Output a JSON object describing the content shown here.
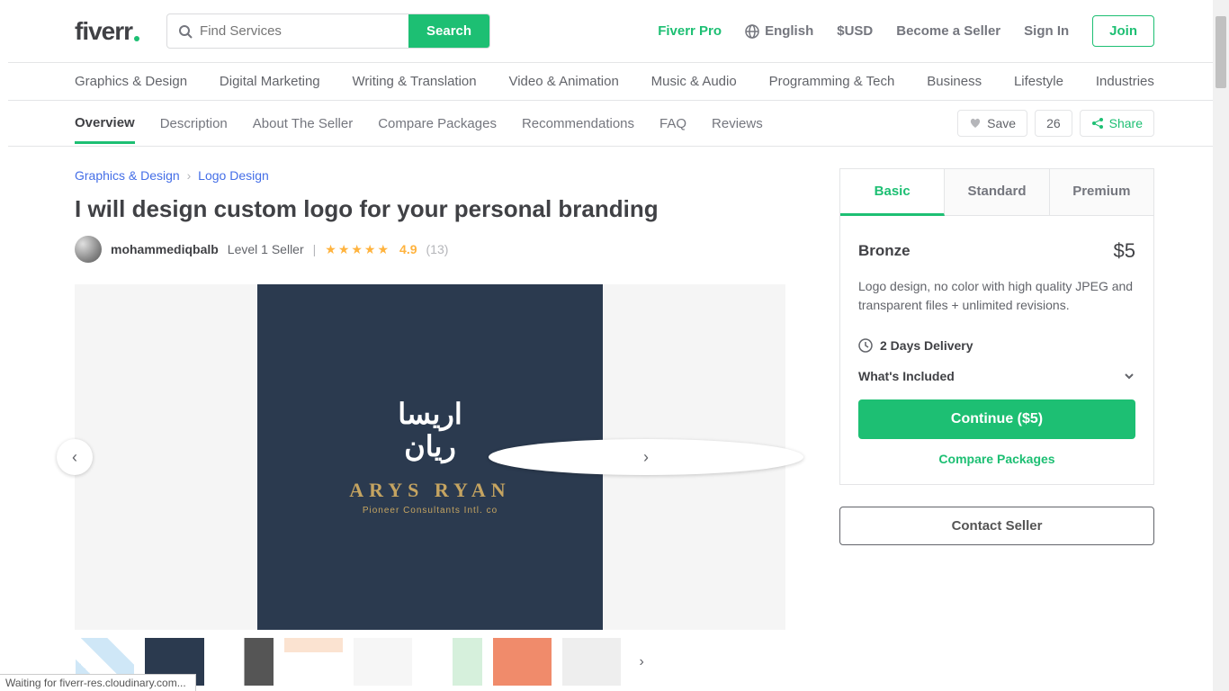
{
  "header": {
    "logo_text": "fiverr",
    "search_placeholder": "Find Services",
    "search_button": "Search",
    "nav": {
      "pro": "Fiverr Pro",
      "language": "English",
      "currency": "$USD",
      "seller": "Become a Seller",
      "signin": "Sign In",
      "join": "Join"
    }
  },
  "categories": [
    "Graphics & Design",
    "Digital Marketing",
    "Writing & Translation",
    "Video & Animation",
    "Music & Audio",
    "Programming & Tech",
    "Business",
    "Lifestyle",
    "Industries"
  ],
  "subnav": {
    "items": [
      "Overview",
      "Description",
      "About The Seller",
      "Compare Packages",
      "Recommendations",
      "FAQ",
      "Reviews"
    ],
    "save": "Save",
    "save_count": "26",
    "share": "Share"
  },
  "breadcrumb": {
    "a": "Graphics & Design",
    "b": "Logo Design"
  },
  "title": "I will design custom logo for your personal branding",
  "seller": {
    "name": "mohammediqbalb",
    "level": "Level 1 Seller",
    "rating": "4.9",
    "reviews": "(13)"
  },
  "slide": {
    "arabic": "اريسا\nريان",
    "name": "ARYS RYAN",
    "tag": "Pioneer Consultants Intl. co"
  },
  "packages": {
    "tabs": [
      "Basic",
      "Standard",
      "Premium"
    ],
    "basic": {
      "name": "Bronze",
      "price": "$5",
      "desc": "Logo design, no color with high quality JPEG and transparent files + unlimited revisions.",
      "delivery": "2 Days Delivery",
      "included": "What's Included",
      "cta": "Continue ($5)",
      "compare": "Compare Packages"
    },
    "contact": "Contact Seller"
  },
  "status": "Waiting for fiverr-res.cloudinary.com..."
}
